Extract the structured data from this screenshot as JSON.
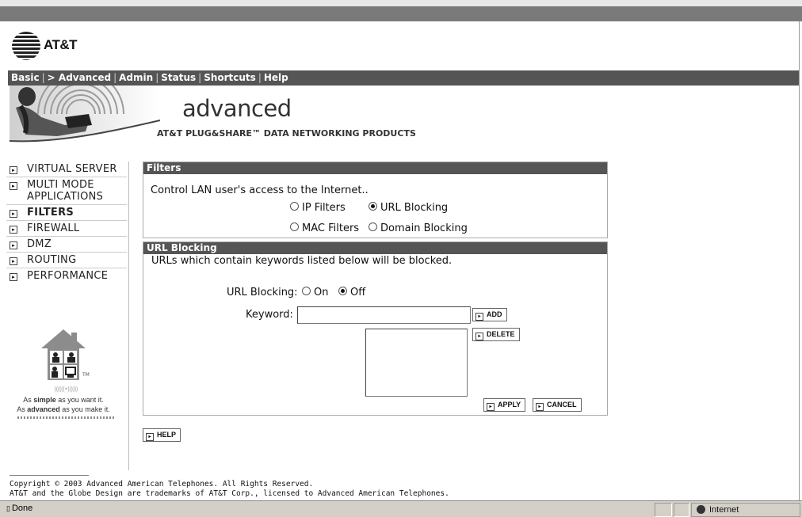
{
  "brand": {
    "logo_text": "AT&T"
  },
  "nav": {
    "items": [
      "Basic",
      "> Advanced",
      "Admin",
      "Status",
      "Shortcuts",
      "Help"
    ]
  },
  "banner": {
    "title": "advanced",
    "subtitle": "AT&T PLUG&SHARE™ DATA NETWORKING PRODUCTS"
  },
  "menu": {
    "items": [
      {
        "label": "VIRTUAL SERVER",
        "active": false
      },
      {
        "label": "MULTI MODE APPLICATIONS",
        "active": false
      },
      {
        "label": "FILTERS",
        "active": true
      },
      {
        "label": "FIREWALL",
        "active": false
      },
      {
        "label": "DMZ",
        "active": false
      },
      {
        "label": "ROUTING",
        "active": false
      },
      {
        "label": "PERFORMANCE",
        "active": false
      }
    ]
  },
  "sidebar_logo": {
    "tm": "TM",
    "wave": "((((((•))))))",
    "tag_simple": "As simple as you want it.",
    "tag_advanced": "As advanced as you make it."
  },
  "filters": {
    "header": "Filters",
    "description": "Control LAN user's access to the Internet..",
    "options": {
      "ip": "IP Filters",
      "url": "URL Blocking",
      "mac": "MAC Filters",
      "domain": "Domain Blocking"
    },
    "selected": "URL Blocking"
  },
  "url_blocking": {
    "header": "URL Blocking",
    "description": "URLs which contain keywords listed below will be blocked.",
    "toggle_label": "URL Blocking:",
    "on_label": "On",
    "off_label": "Off",
    "state": "Off",
    "keyword_label": "Keyword:",
    "keyword_value": "",
    "add_label": "ADD",
    "delete_label": "DELETE",
    "apply_label": "APPLY",
    "cancel_label": "CANCEL"
  },
  "help_label": "HELP",
  "footer": {
    "copyright": "Copyright © 2003 Advanced American Telephones. All Rights Reserved.",
    "trademark": "AT&T and the Globe Design are trademarks of AT&T Corp., licensed to Advanced American Telephones."
  },
  "statusbar": {
    "status": "Done",
    "zone": "Internet"
  }
}
